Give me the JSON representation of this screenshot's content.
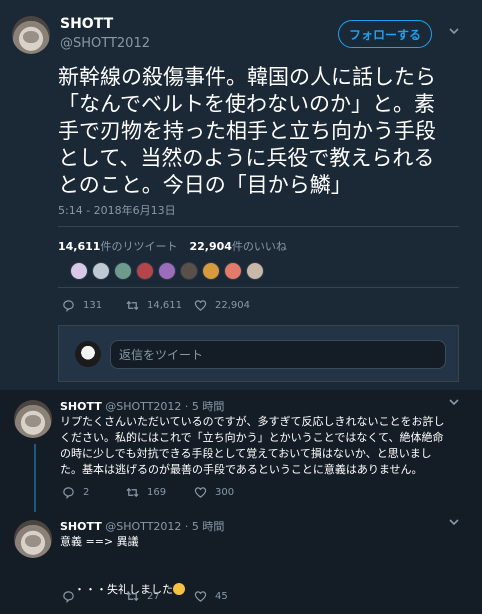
{
  "main_tweet": {
    "name": "SHOTT",
    "handle": "@SHOTT2012",
    "follow_label": "フォローする",
    "text": "新幹線の殺傷事件。韓国の人に話したら\n「なんでベルトを使わないのか」と。素\n手で刃物を持った相手と立ち向かう手段\nとして、当然のように兵役で教えられる\nとのこと。今日の「目から鱗」",
    "timestamp": "5:14 - 2018年6月13日",
    "retweet_count": "14,611",
    "retweet_label": "件のリツイート",
    "like_count": "22,904",
    "like_label": "件のいいね",
    "likers": [
      "#d9c7e8",
      "#bfc9d4",
      "#6e9b8c",
      "#b3454b",
      "#9b6dbb",
      "#5b4f49",
      "#d79a3c",
      "#e37a6a",
      "#c8b8a8"
    ],
    "actions": {
      "replies": "131",
      "retweets": "14,611",
      "likes": "22,904"
    },
    "reply_placeholder": "返信をツイート"
  },
  "replies": [
    {
      "name": "SHOTT",
      "meta": "@SHOTT2012 · 5 時間",
      "text": "リプたくさんいただいているのですが、多すぎて反応しきれないことをお許し\nください。私的にはこれで「立ち向かう」とかいうことではなくて、絶体絶命\nの時に少しでも対抗できる手段として覚えておいて損はないか、と思いまし\nた。基本は逃げるのが最善の手段であるということに意義はありません。",
      "actions": {
        "replies": "2",
        "retweets": "169",
        "likes": "300"
      }
    },
    {
      "name": "SHOTT",
      "meta": "@SHOTT2012 · 5 時間",
      "line1": "意義 ==> 異議",
      "line2": "・・・失礼しました",
      "actions": {
        "replies": "",
        "retweets": "27",
        "likes": "45"
      }
    }
  ],
  "icons": [
    "chevron-down-icon",
    "reply-icon",
    "retweet-icon",
    "like-icon",
    "emoji-sweat-smile"
  ],
  "colors": {
    "accent": "#1da1f2",
    "background": "#141d26",
    "card": "#1b2836",
    "muted": "#8899a6"
  }
}
